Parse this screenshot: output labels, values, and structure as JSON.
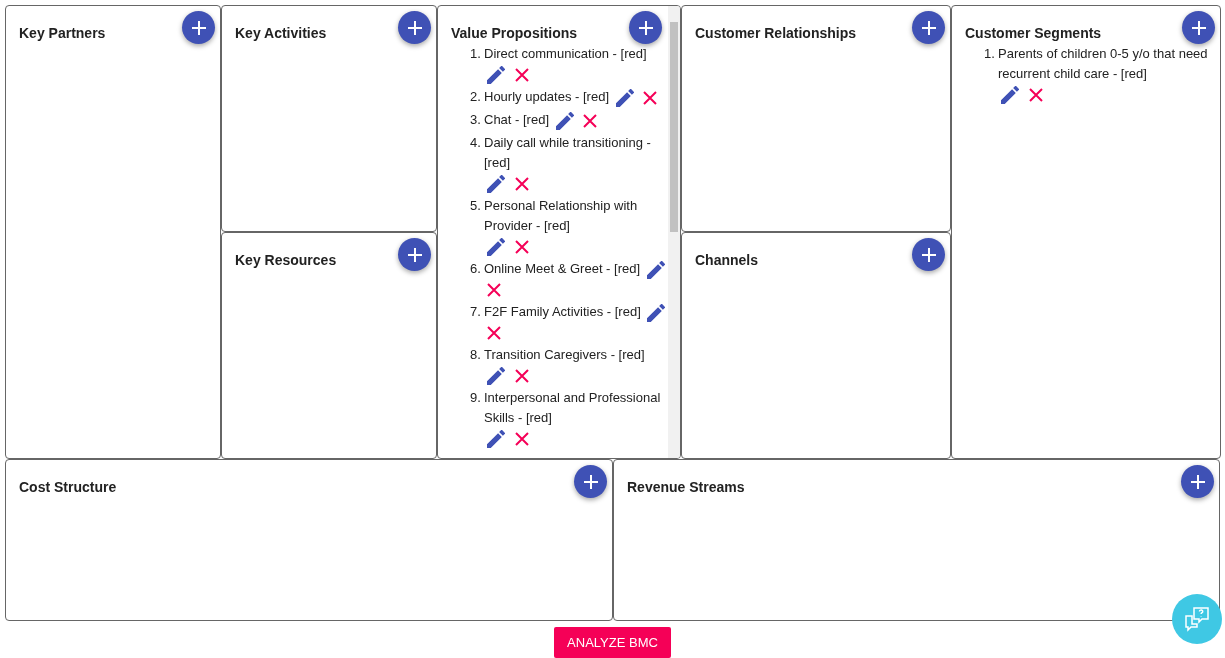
{
  "top_panels": [
    {
      "title": "Key Partners"
    },
    {
      "title": "Key Activities"
    },
    {
      "title": "Key Resources"
    },
    {
      "title": "Value Propositions",
      "scrollable": true,
      "items": [
        {
          "number": "1.",
          "text": "Direct communication - [red]"
        },
        {
          "number": "2.",
          "text": "Hourly updates - [red]"
        },
        {
          "number": "3.",
          "text": "Chat - [red]"
        },
        {
          "number": "4.",
          "text": "Daily call while transitioning - [red]"
        },
        {
          "number": "5.",
          "text": "Personal Relationship with Provider - [red]"
        },
        {
          "number": "6.",
          "text": "Online Meet & Greet - [red]"
        },
        {
          "number": "7.",
          "text": "F2F Family Activities - [red]"
        },
        {
          "number": "8.",
          "text": "Transition Caregivers - [red]"
        },
        {
          "number": "9.",
          "text": "Interpersonal and Professional Skills - [red]"
        }
      ]
    },
    {
      "title": "Customer Relationships"
    },
    {
      "title": "Channels"
    },
    {
      "title": "Customer Segments",
      "items": [
        {
          "number": "1.",
          "text": "Parents of children 0-5 y/o that need recurrent child care - [red]"
        }
      ]
    }
  ],
  "bottom_panels": [
    {
      "title": "Cost Structure"
    },
    {
      "title": "Revenue Streams"
    }
  ],
  "analyze_button": "ANALYZE BMC"
}
